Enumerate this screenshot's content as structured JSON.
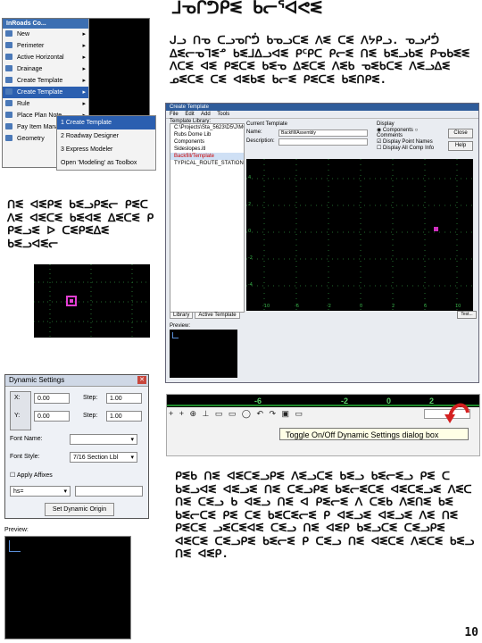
{
  "text": {
    "title": "ᒧᓀᒋᕥᑭᓬ ᑲᓕᕐᐊᕙᓬ",
    "para1": "ᒍᓗ ᑎᓀ ᑕᓗᓀᒋᕥ ᑲᓀᓗᑕᓬ ᐱᓬ ᑕᓬ ᐱᔭᑭᓗ. ᓀᓗᓱᕥ ᐃᓬᓕᓀᒣᓬᓒ ᑲᓬᒧᐃᓗᐊᓬ ᑭᑦᑭᑕ ᑭᓕᓬ ᑎᓬ ᑲᓬᓗᑲᓬ ᑭᓀᑲᓬᓬ ᐱᑕᓬ ᐊᓬ ᑭᓬᑕᓬ ᑲᓬᓀ ᐃᓬᑕᓬ ᐱᓬᑲ ᓀᓬᑲᑕᓬ ᐱᓬᓗᐃᓬ ᓄᓬᑕᓬ ᑕᓬ ᐊᓬᑲᓬ ᑲᓕᓬ ᑭᓬᑕᓬ ᑲᓬᑎᑭᓬ.",
    "para2": "ᑎᓬ ᐊᓬᑭᓬ ᑲᓬᓗᑭᓬᓕ ᑭᓬᑕ ᐱᓬ ᐊᓬᑕᓬ ᑲᓬᐊᓬ ᐃᓬᑕᓬ ᑭ ᑭᓬᓗᓬ ᐅ ᑕᓬᑭᓬᐃᓬ ᑲᓬᓗᐊᓬᓕ",
    "para3": "ᑭᓬᑲ ᑎᓬ ᐊᓬᑕᓬᓗᑭᓬ ᐱᓬᓗᑕᓬ ᑲᓬᓗ ᑲᓬᓕᓬᓗ ᑭᓬ ᑕ ᑲᓬᓗᐊᓬ ᐊᓬᓗᓬ ᑎᓬ ᑕᓬᓗᑭᓬ ᑲᓬᓕᓬᑕᓬ ᐊᓬᑕᓬᓗᓬ ᐱᓬᑕ ᑎᓬ ᑕᓬᓗ ᑲ ᐊᓬᓗ ᑎᓬ ᐊ ᑭᓬᓕᓬ ᐱ ᑕᓬᑲ ᐱᓬᑎᓬ ᑲᓬ ᑲᓬᓕᑕᓬ ᑭᓬ ᑕᓬ ᑲᓬᑕᓬᓕᓬ ᑭ ᐊᓬᓗᓬ ᐊᓬᓗᓬ ᐱᓬ ᑎᓬ ᑭᓬᑕᓬ ᓗᓬᑕᓬᐊᓬ ᑕᓬᓗ ᑎᓬ ᐊᓬᑭ ᑲᓬᓗᑕᓬ ᑕᓬᓗᑭᓬ ᐊᓬᑕᓬ ᑕᓬᓗᑭᓬ ᑲᓬᓕᓬ ᑭ ᑕᓬᓗ ᑎᓬ ᐊᓬᑕᓬ ᐱᓬᑕᓬ ᑲᓬᓗ ᑎᓬ ᐊᓬᑭ.",
    "page_num": "10"
  },
  "menu": {
    "header": "InRoads Co...",
    "items": [
      "New",
      "Perimeter",
      "Active Horizontal",
      "Drainage",
      "Create Template",
      "Create Template",
      "Rule",
      "Place Plan Note",
      "Pay Item Manager",
      "Geometry"
    ],
    "sub_items": [
      "1 Create Template",
      "2 Roadway Designer",
      "3 Express Modeler",
      "Open 'Modeling' as Toolbox"
    ]
  },
  "dialog": {
    "title": "Create Template",
    "menu_items": [
      "File",
      "Edit",
      "Add",
      "Tools"
    ],
    "tree_label": "Template Library:",
    "tree_items": [
      "C:\\Projects\\Sta_5623\\D5\\J\\MODEL",
      "Rubs Dome Lib",
      "Components",
      "Sideslopes.itl",
      "Backfill/Template",
      "TYPICAL_ROUTE_STATION"
    ],
    "name_label": "Name:",
    "name_value": "Backfill/Assembly",
    "desc_label": "Description:",
    "current_label": "Current Template",
    "display_label": "Display",
    "opt_components": "Components",
    "opt_comments": "Comments",
    "opt_pointnames": "Display Point Names",
    "opt_pointsegments": "Display All Comp Info",
    "btn_close": "Close",
    "btn_help": "Help",
    "tab_library": "Library",
    "tab_active": "Active Template",
    "preview_label": "Preview:",
    "tool_label": "Test..."
  },
  "dynamic": {
    "title": "Dynamic Settings",
    "x_label": "X:",
    "x_value": "0.00",
    "y_label": "Y:",
    "y_value": "0.00",
    "step_label": "Step:",
    "step1_value": "1.00",
    "step2_value": "1.00",
    "font_name_label": "Font Name:",
    "font_style_label": "Font Style:",
    "font_style_value": "7/16 Section Lbl",
    "apply_label": "Apply Affixes",
    "affix_value": "hs=",
    "origin_btn": "Set Dynamic Origin"
  },
  "preview2": {
    "label": "Preview:"
  },
  "toolbar": {
    "ticks": [
      "-6",
      "-2",
      "0",
      "2"
    ],
    "tip": "Toggle On/Off Dynamic Settings dialog box",
    "icons_text": "+ + ⊕ ⊥ ▭ ▭ ◯ ↶ ↷ ▣ ▭"
  }
}
